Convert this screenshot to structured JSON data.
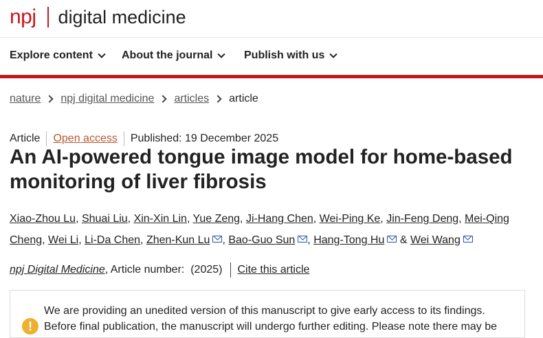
{
  "header": {
    "logo_npj": "npj",
    "logo_name": "digital medicine"
  },
  "nav": [
    {
      "label": "Explore content"
    },
    {
      "label": "About the journal"
    },
    {
      "label": "Publish with us"
    }
  ],
  "breadcrumb": {
    "nature": "nature",
    "journal": "npj digital medicine",
    "articles": "articles",
    "current": "article"
  },
  "meta": {
    "type": "Article",
    "access": "Open access",
    "published": "Published: 19 December 2025"
  },
  "title": "An AI-powered tongue image model for home-based monitoring of liver fibrosis",
  "authors": [
    "Xiao-Zhou Lu",
    "Shuai Liu",
    "Xin-Xin Lin",
    "Yue Zeng",
    "Ji-Hang Chen",
    "Wei-Ping Ke",
    "Jin-Feng Deng",
    "Mei-Qing Cheng",
    "Wei Li",
    "Li-Da Chen",
    "Zhen-Kun Lu",
    "Bao-Guo Sun",
    "Hang-Tong Hu",
    "Wei Wang"
  ],
  "authors_and": "&",
  "journal_line": {
    "journal": "npj Digital Medicine",
    "article_number": ", Article number:  (2025)",
    "cite": "Cite this article"
  },
  "notice": {
    "icon": "!",
    "text": "We are providing an unedited version of this manuscript to give early access to its findings. Before final publication, the manuscript will undergo further editing. Please note there may be"
  }
}
